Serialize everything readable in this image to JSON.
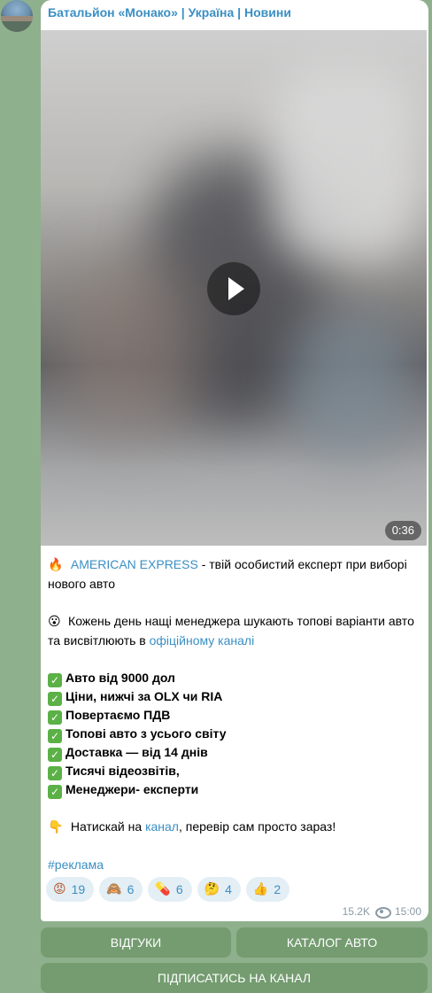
{
  "channel": {
    "name": "Батальйон «Монако» | Україна | Новини"
  },
  "video": {
    "duration": "0:36"
  },
  "post": {
    "lines": [
      {
        "id": "l1",
        "parts": [
          "🔥 ",
          "AMERICAN EXPRESS",
          " - твій особистий експерт при виборі нового авто"
        ]
      },
      {
        "id": "l2",
        "parts": [
          "😮 ",
          "Кожень день нащі менеджера шукають топові варіанти авто та висвітлюють в ",
          "офіційному каналі"
        ]
      },
      {
        "id": "checks",
        "items": [
          "Авто від 9000 дол",
          "Ціни, нижчі за OLX чи RIA",
          "Повертаємо ПДВ",
          "Топові авто з усього світу",
          "Доставка — від 14 днів",
          "Тисячі відеозвітів,",
          "Менеджери- експерти"
        ]
      },
      {
        "id": "l3",
        "parts": [
          "👇 ",
          "Натискай на ",
          "канал",
          ", перевір сам просто зараз!"
        ]
      },
      {
        "id": "tag",
        "parts": [
          "#реклама"
        ]
      }
    ]
  },
  "reactions": [
    {
      "emoji": "😡",
      "count": "19"
    },
    {
      "emoji": "🙈",
      "count": "6"
    },
    {
      "emoji": "💊",
      "count": "6"
    },
    {
      "emoji": "🤔",
      "count": "4"
    },
    {
      "emoji": "👍",
      "count": "2"
    }
  ],
  "meta": {
    "views": "15.2K",
    "time": "15:00"
  },
  "buttons": {
    "reviews": "ВІДГУКИ",
    "catalog": "КАТАЛОГ АВТО",
    "subscribe": "ПІДПИСАТИСЬ НА КАНАЛ"
  }
}
